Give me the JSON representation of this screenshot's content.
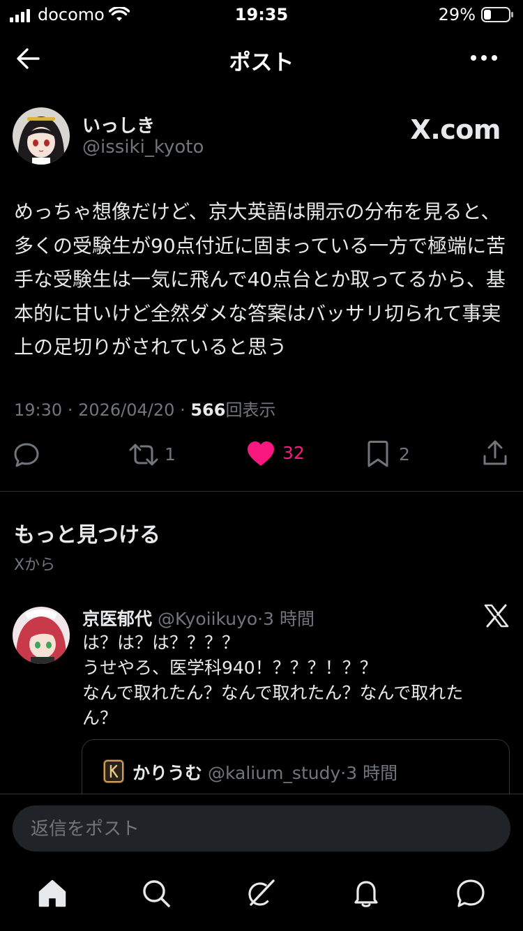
{
  "status_bar": {
    "carrier": "docomo",
    "time": "19:35",
    "battery": "29%"
  },
  "header": {
    "title": "ポスト",
    "back_icon": "arrow-left-icon",
    "more_icon": "ellipsis-icon"
  },
  "post": {
    "author_name": "いっしき",
    "author_handle": "@issiki_kyoto",
    "source": "X.com",
    "body": "めっちゃ想像だけど、京大英語は開示の分布を見ると、多くの受験生が90点付近に固まっている一方で極端に苦手な受験生は一気に飛んで40点台とか取ってるから、基本的に甘いけど全然ダメな答案はバッサリ切られて事実上の足切りがされていると思う",
    "time": "19:30",
    "separator": "·",
    "date": "2026/04/20",
    "views": "566",
    "views_label": "回表示",
    "actions": {
      "reply_icon": "reply-icon",
      "retweets": "1",
      "likes": "32",
      "liked": true,
      "bookmarks": "2",
      "like_color": "#f91880"
    }
  },
  "more": {
    "title": "もっと見つける",
    "subtitle": "Xから"
  },
  "recommended": {
    "name": "京医郁代",
    "handle": "@Kyoiikuyo",
    "time": "3 時間",
    "source_icon": "x-logo-icon",
    "body": "は？は？は？？？？\nうせやろ、医学科940！？？？！？？\nなんで取れたん？なんで取れたん？なんで取れたん？",
    "quote": {
      "name": "かりうむ",
      "handle": "@kalium_study",
      "time": "3 時間"
    }
  },
  "reply": {
    "placeholder": "返信をポスト"
  },
  "tabs": [
    "home-icon",
    "search-icon",
    "grok-icon",
    "notifications-icon",
    "messages-icon"
  ],
  "colors": {
    "background": "#000000",
    "text": "#e7e9ea",
    "secondary": "#71767b",
    "accent": "#f91880"
  }
}
